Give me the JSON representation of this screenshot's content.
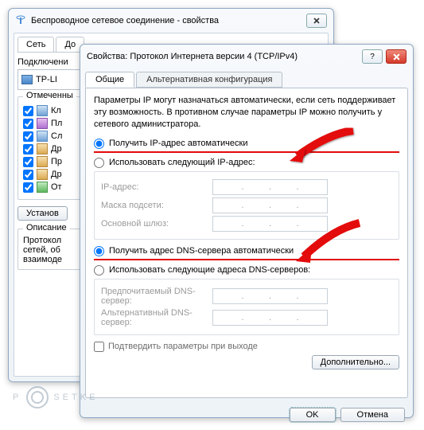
{
  "back": {
    "title": "Беспроводное сетевое соединение - свойства",
    "tabs": {
      "network": "Сеть",
      "access": "До"
    },
    "connect_label": "Подключени",
    "adapter": "TP-LI",
    "checked_label": "Отмеченны",
    "items": [
      "Кл",
      "Пл",
      "Сл",
      "Др",
      "Пр",
      "Др",
      "От"
    ],
    "install_btn": "Установ",
    "desc_label": "Описание",
    "desc_text": "Протокол\nсетей, об\nвзаимоде"
  },
  "front": {
    "title": "Свойства: Протокол Интернета версии 4 (TCP/IPv4)",
    "tabs": {
      "general": "Общие",
      "alt": "Альтернативная конфигурация"
    },
    "desc": "Параметры IP могут назначаться автоматически, если сеть поддерживает эту возможность. В противном случае параметры IP можно получить у сетевого администратора.",
    "radio_ip_auto": "Получить IP-адрес автоматически",
    "radio_ip_manual": "Использовать следующий IP-адрес:",
    "ip_label": "IP-адрес:",
    "mask_label": "Маска подсети:",
    "gw_label": "Основной шлюз:",
    "radio_dns_auto": "Получить адрес DNS-сервера автоматически",
    "radio_dns_manual": "Использовать следующие адреса DNS-серверов:",
    "dns1_label": "Предпочитаемый DNS-сервер:",
    "dns2_label": "Альтернативный DNS-сервер:",
    "confirm": "Подтвердить параметры при выходе",
    "advanced": "Дополнительно...",
    "ok": "OK",
    "cancel": "Отмена"
  },
  "watermark": {
    "p": "P",
    "rest": "SETKE"
  }
}
